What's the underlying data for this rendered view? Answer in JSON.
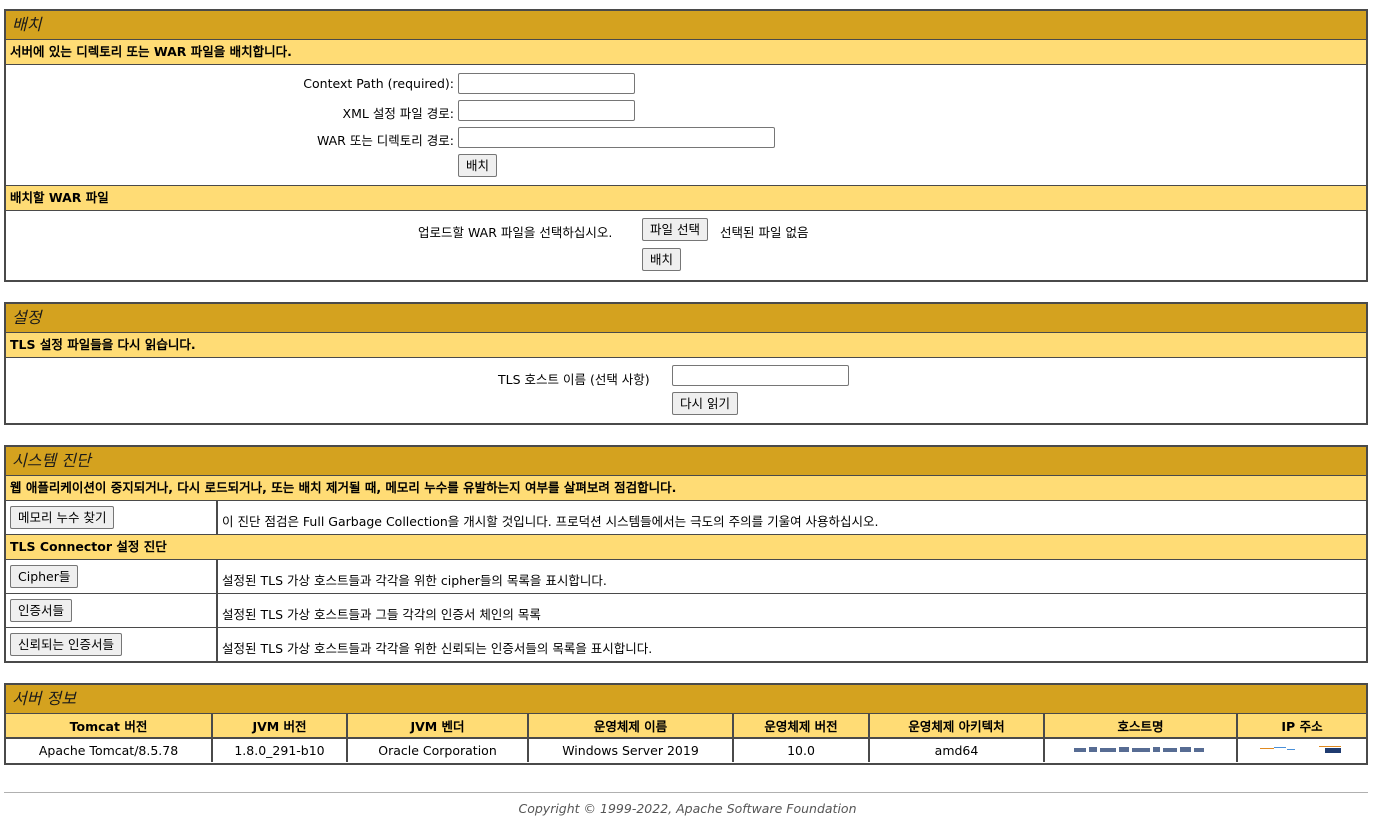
{
  "deploy": {
    "title": "배치",
    "subtitle": "서버에 있는 디렉토리 또는 WAR 파일을 배치합니다.",
    "context_path_label": "Context Path (required):",
    "xml_config_label": "XML 설정 파일 경로:",
    "war_dir_label": "WAR 또는 디렉토리 경로:",
    "deploy_button": "배치",
    "war_section_title": "배치할 WAR 파일",
    "upload_label": "업로드할 WAR 파일을 선택하십시오.",
    "choose_file_button": "파일 선택",
    "no_file_text": "선택된 파일 없음",
    "war_deploy_button": "배치"
  },
  "config": {
    "title": "설정",
    "subtitle": "TLS 설정 파일들을 다시 읽습니다.",
    "host_label": "TLS 호스트 이름 (선택 사항)",
    "reload_button": "다시 읽기"
  },
  "diagnostics": {
    "title": "시스템 진단",
    "subtitle": "웹 애플리케이션이 중지되거나, 다시 로드되거나, 또는 배치 제거될 때, 메모리 누수를 유발하는지 여부를 살펴보려 점검합니다.",
    "find_leaks_button": "메모리 누수 찾기",
    "find_leaks_desc": "이 진단 점검은 Full Garbage Collection을 개시할 것입니다. 프로덕션 시스템들에서는 극도의 주의를 기울여 사용하십시오.",
    "tls_subtitle": "TLS Connector 설정 진단",
    "ciphers_button": "Cipher들",
    "ciphers_desc": "설정된 TLS 가상 호스트들과 각각을 위한 cipher들의 목록을 표시합니다.",
    "certs_button": "인증서들",
    "certs_desc": "설정된 TLS 가상 호스트들과 그들 각각의 인증서 체인의 목록",
    "trusted_button": "신뢰되는 인증서들",
    "trusted_desc": "설정된 TLS 가상 호스트들과 각각을 위한 신뢰되는 인증서들의 목록을 표시합니다."
  },
  "server_info": {
    "title": "서버 정보",
    "headers": [
      "Tomcat 버전",
      "JVM 버전",
      "JVM 벤더",
      "운영체제 이름",
      "운영체제 버전",
      "운영체제 아키텍처",
      "호스트명",
      "IP 주소"
    ],
    "values": [
      "Apache Tomcat/8.5.78",
      "1.8.0_291-b10",
      "Oracle Corporation",
      "Windows Server 2019",
      "10.0",
      "amd64"
    ]
  },
  "footer": {
    "copyright": "Copyright © 1999-2022, Apache Software Foundation"
  }
}
